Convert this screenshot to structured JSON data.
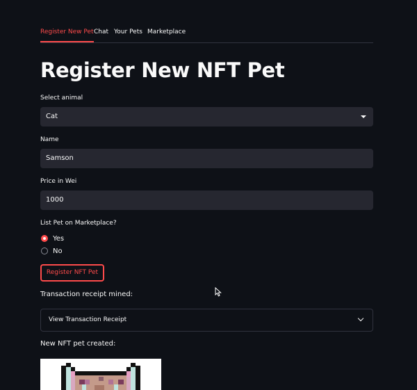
{
  "tabs": [
    {
      "label": "Register New Pet",
      "active": true
    },
    {
      "label": "Chat",
      "active": false
    },
    {
      "label": "Your Pets",
      "active": false
    },
    {
      "label": "Marketplace",
      "active": false
    }
  ],
  "page_title": "Register New NFT Pet",
  "animal": {
    "label": "Select animal",
    "value": "Cat"
  },
  "name": {
    "label": "Name",
    "value": "Samson"
  },
  "price": {
    "label": "Price in Wei",
    "value": "1000"
  },
  "list_on_marketplace": {
    "label": "List Pet on Marketplace?",
    "options": [
      {
        "label": "Yes",
        "selected": true
      },
      {
        "label": "No",
        "selected": false
      }
    ]
  },
  "register_button_label": "Register NFT Pet",
  "receipt": {
    "heading": "Transaction receipt mined:",
    "expander_label": "View Transaction Receipt"
  },
  "created_heading": "New NFT pet created:",
  "colors": {
    "accent": "#ff4b4b",
    "background": "#0e1117",
    "input_bg": "#262730"
  },
  "icons": [
    "chevron-down-icon",
    "dropdown-caret-icon",
    "mouse-cursor-icon"
  ]
}
